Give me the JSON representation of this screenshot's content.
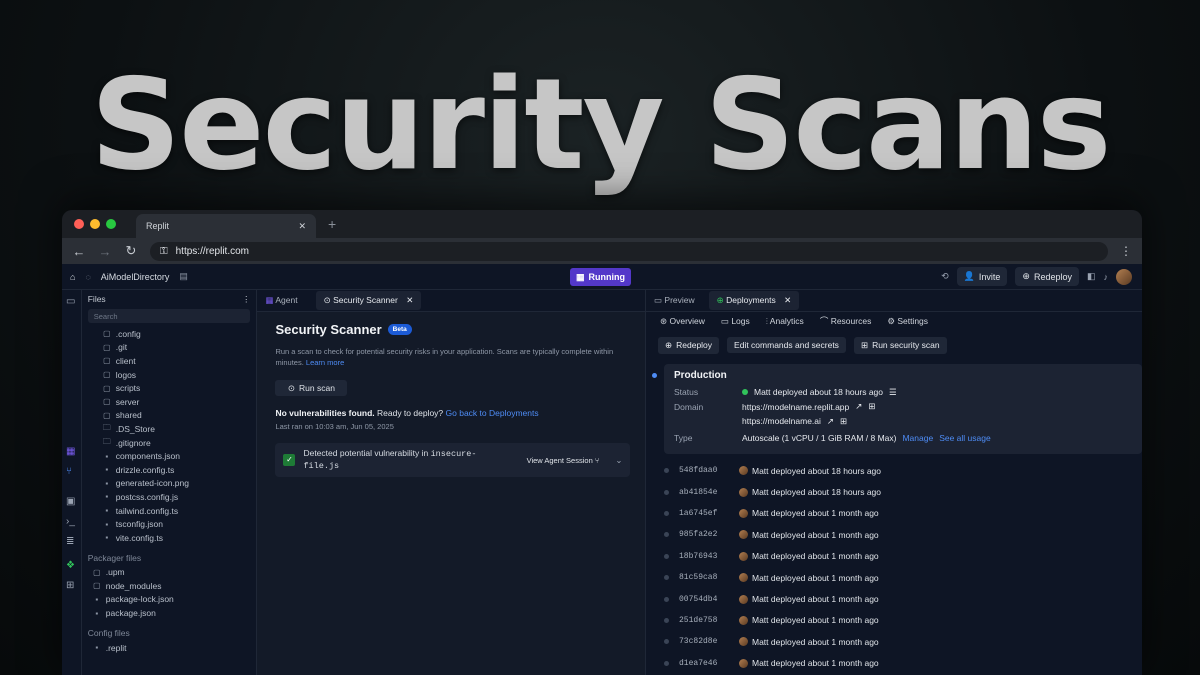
{
  "hero": {
    "title": "Security Scans"
  },
  "browser": {
    "tab_title": "Replit",
    "url": "https://replit.com"
  },
  "topbar": {
    "repl_name": "AiModelDirectory",
    "status": "Running",
    "invite": "Invite",
    "redeploy": "Redeploy"
  },
  "files": {
    "header": "Files",
    "search_placeholder": "Search",
    "items": [
      ".config",
      ".git",
      "client",
      "logos",
      "scripts",
      "server",
      "shared",
      ".DS_Store",
      ".gitignore",
      "components.json",
      "drizzle.config.ts",
      "generated-icon.png",
      "postcss.config.js",
      "tailwind.config.ts",
      "tsconfig.json",
      "vite.config.ts"
    ],
    "packager_title": "Packager files",
    "packager_items": [
      ".upm",
      "node_modules",
      "package-lock.json",
      "package.json"
    ],
    "config_title": "Config files",
    "config_items": [
      ".replit"
    ]
  },
  "mid": {
    "tab_agent": "Agent",
    "tab_scanner": "Security Scanner",
    "title": "Security Scanner",
    "badge": "Beta",
    "description": "Run a scan to check for potential security risks in your application. Scans are typically complete within minutes.",
    "learn_more": "Learn more",
    "run_scan": "Run scan",
    "no_vuln_bold": "No vulnerabilities found.",
    "no_vuln_text": " Ready to deploy? ",
    "go_back": "Go back to Deployments",
    "last_ran": "Last ran on 10:03 am, Jun 05, 2025",
    "vuln_text": "Detected potential vulnerability in ",
    "vuln_file1": "insecure-",
    "vuln_file2": "file.js",
    "view_session": "View Agent Session"
  },
  "right": {
    "tab_preview": "Preview",
    "tab_deployments": "Deployments",
    "tabs": [
      "Overview",
      "Logs",
      "Analytics",
      "Resources",
      "Settings"
    ],
    "btn_redeploy": "Redeploy",
    "btn_edit": "Edit commands and secrets",
    "btn_scan": "Run security scan",
    "prod_title": "Production",
    "status_label": "Status",
    "status_value": "Matt deployed about 18 hours ago",
    "domain_label": "Domain",
    "domain1": "https://modelname.replit.app",
    "domain2": "https://modelname.ai",
    "type_label": "Type",
    "type_value": "Autoscale (1 vCPU / 1 GiB RAM / 8 Max)",
    "manage": "Manage",
    "see_usage": "See all usage",
    "deploys": [
      {
        "hash": "548fdaa0",
        "text": "Matt deployed about 18 hours ago"
      },
      {
        "hash": "ab41854e",
        "text": "Matt deployed about 18 hours ago"
      },
      {
        "hash": "1a6745ef",
        "text": "Matt deployed about 1 month ago"
      },
      {
        "hash": "985fa2e2",
        "text": "Matt deployed about 1 month ago"
      },
      {
        "hash": "18b76943",
        "text": "Matt deployed about 1 month ago"
      },
      {
        "hash": "81c59ca8",
        "text": "Matt deployed about 1 month ago"
      },
      {
        "hash": "00754db4",
        "text": "Matt deployed about 1 month ago"
      },
      {
        "hash": "251de758",
        "text": "Matt deployed about 1 month ago"
      },
      {
        "hash": "73c82d8e",
        "text": "Matt deployed about 1 month ago"
      },
      {
        "hash": "d1ea7e46",
        "text": "Matt deployed about 1 month ago"
      }
    ]
  }
}
